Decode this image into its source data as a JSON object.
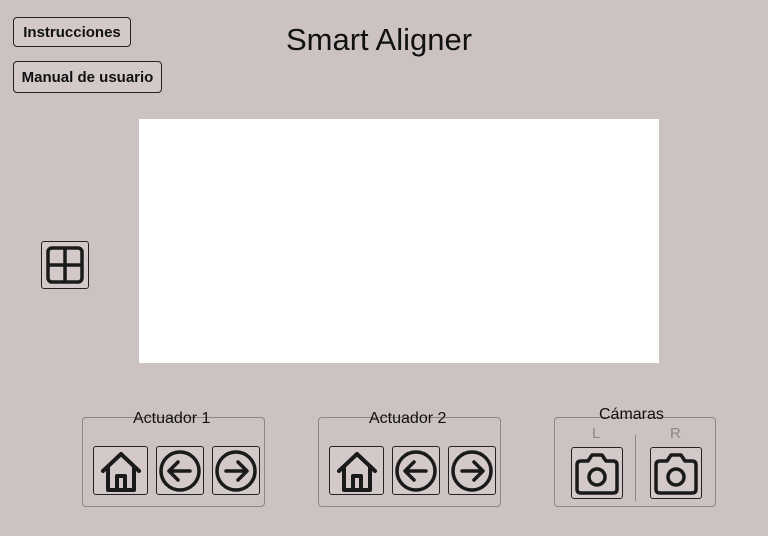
{
  "header": {
    "instructions_label": "Instrucciones",
    "manual_label": "Manual de usuario",
    "title": "Smart Aligner"
  },
  "actuator1": {
    "title": "Actuador 1",
    "icons": [
      "home-icon",
      "arrow-left-circle-icon",
      "arrow-right-circle-icon"
    ]
  },
  "actuator2": {
    "title": "Actuador 2",
    "icons": [
      "home-icon",
      "arrow-left-circle-icon",
      "arrow-right-circle-icon"
    ]
  },
  "cameras": {
    "title": "Cámaras",
    "left_label": "L",
    "right_label": "R",
    "icons": [
      "camera-icon",
      "camera-icon"
    ]
  },
  "viewer": {
    "background": "#ffffff"
  },
  "grid_button": {
    "icon": "grid-layout-icon"
  },
  "colors": {
    "background": "#cdc2c2",
    "button": "#d3c9c9",
    "border": "#222222",
    "muted_label": "#8f8585"
  }
}
